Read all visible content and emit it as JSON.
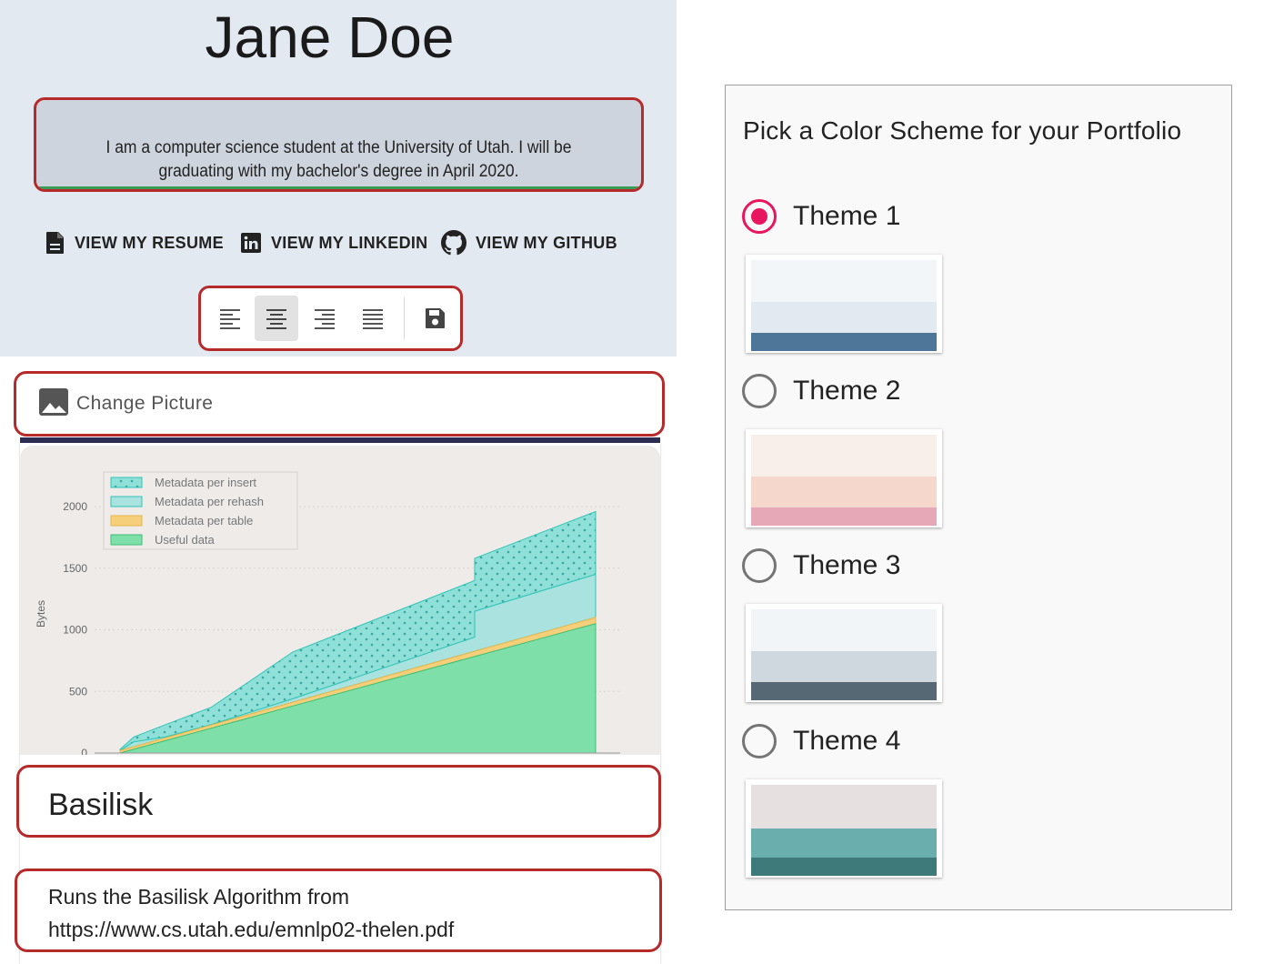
{
  "profile": {
    "name": "Jane Doe",
    "bio": "I am a computer science student at the University of Utah. I will be graduating with my bachelor's degree in April 2020."
  },
  "links": [
    {
      "label": "VIEW MY RESUME",
      "icon": "file-icon"
    },
    {
      "label": "VIEW MY LINKEDIN",
      "icon": "linkedin-icon"
    },
    {
      "label": "VIEW MY GITHUB",
      "icon": "github-icon"
    }
  ],
  "toolbar": {
    "buttons": [
      "align-left",
      "align-center",
      "align-right",
      "align-justify",
      "save"
    ],
    "active": "align-center"
  },
  "picture": {
    "change_label": "Change Picture",
    "icon": "image-icon"
  },
  "project": {
    "title": "Basilisk",
    "description": "Runs the Basilisk Algorithm from https://www.cs.utah.edu/emnlp02-thelen.pdf"
  },
  "chart_data": {
    "type": "area",
    "ylabel": "Bytes",
    "yticks": [
      "2000",
      "1500",
      "1000",
      "500",
      "0"
    ],
    "ylim": [
      0,
      2100
    ],
    "legend_position": "top-left",
    "legend": [
      "Metadata per insert",
      "Metadata per rehash",
      "Metadata per table",
      "Useful data"
    ],
    "series": [
      {
        "name": "Useful data",
        "color": "#7fdfa9"
      },
      {
        "name": "Metadata per table",
        "color": "#f5cf7a"
      },
      {
        "name": "Metadata per rehash",
        "color": "#a9e2df"
      },
      {
        "name": "Metadata per insert",
        "color": "#8fe0d8"
      }
    ],
    "approx_final_totals": {
      "Useful data": 1050,
      "Metadata per table": 1080,
      "Metadata per rehash": 1450,
      "Metadata per insert": 1960
    }
  },
  "themes": {
    "heading": "Pick a Color Scheme for your Portfolio",
    "selected": 0,
    "items": [
      {
        "label": "Theme 1",
        "colors": [
          "#f3f6f9",
          "#e3e9f1",
          "#4e7698"
        ]
      },
      {
        "label": "Theme 2",
        "colors": [
          "#f8efea",
          "#f5d7cb",
          "#e6a7b7"
        ]
      },
      {
        "label": "Theme 3",
        "colors": [
          "#f1f5f8",
          "#cfd8df",
          "#566874"
        ]
      },
      {
        "label": "Theme 4",
        "colors": [
          "#e6e1e0",
          "#6aaeae",
          "#3e7a7a"
        ]
      }
    ]
  }
}
